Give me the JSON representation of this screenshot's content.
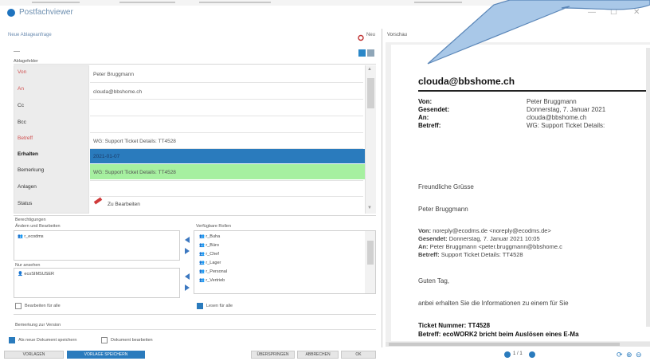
{
  "window": {
    "title": "Postfachviewer",
    "controls": [
      "—",
      "☐",
      "✕"
    ]
  },
  "left": {
    "header": "Neue Ablageanfrage",
    "new_label": "Neu",
    "group_title": "Ablagefelder",
    "fields": [
      {
        "label": "Von",
        "value": "Peter Bruggmann",
        "style": "red"
      },
      {
        "label": "An",
        "value": "clouda@bbshome.ch",
        "style": "red"
      },
      {
        "label": "Cc",
        "value": "",
        "style": "black"
      },
      {
        "label": "Bcc",
        "value": "",
        "style": "black"
      },
      {
        "label": "Betreff",
        "value": "WG: Support Ticket Details: TT4528",
        "style": "red"
      },
      {
        "label": "Erhalten",
        "value": "2021-01-07",
        "style": "bold"
      },
      {
        "label": "Bemerkung",
        "value": "WG: Support Ticket Details: TT4528",
        "style": "black"
      },
      {
        "label": "Anlagen",
        "value": "",
        "style": "black"
      },
      {
        "label": "Status",
        "value": "Zu Bearbeiten",
        "style": "black"
      }
    ],
    "permissions": {
      "title": "Berechtigungen",
      "read_write_caption": "Ändern und Bearbeiten",
      "read_write_items": [
        "r_ecodms"
      ],
      "read_only_caption": "Nur ansehen",
      "read_only_items": [
        "ecoSIMSUSER"
      ],
      "available_caption": "Verfügbare Rollen",
      "available_items": [
        "r_Buha",
        "r_Büro",
        "r_Chef",
        "r_Lager",
        "r_Personal",
        "r_Vertrieb"
      ],
      "edit_all_label": "Bearbeiten für alle",
      "read_all_label": "Lesen für alle"
    },
    "note_label": "Bemerkung zur Version",
    "option1_label": "Als neue Dokument speichern",
    "option2_label": "Dokument bearbeiten",
    "buttons": {
      "vorlagen": "VORLAGEN",
      "vorlage_speichern": "VORLAGE SPEICHERN",
      "ueberspringen": "ÜBERSPRINGEN",
      "abbrechen": "ABBRECHEN",
      "ok": "OK"
    }
  },
  "preview": {
    "label": "Vorschau",
    "mailbox": "clouda@bbshome.ch",
    "header_fields": [
      {
        "label": "Von:",
        "value": "Peter Bruggmann"
      },
      {
        "label": "Gesendet:",
        "value": "Donnerstag, 7. Januar 2021"
      },
      {
        "label": "An:",
        "value": "clouda@bbshome.ch"
      },
      {
        "label": "Betreff:",
        "value": "WG: Support Ticket Details:"
      }
    ],
    "greeting": "Freundliche Grüsse",
    "signature": "Peter Bruggmann",
    "fwd_von_label": "Von:",
    "fwd_von": "noreply@ecodms.de <noreply@ecodms.de>",
    "fwd_gesendet_label": "Gesendet:",
    "fwd_gesendet": "Donnerstag, 7. Januar 2021 10:05",
    "fwd_an_label": "An:",
    "fwd_an": "Peter Bruggmann <peter.bruggmann@bbshome.c",
    "fwd_betreff_label": "Betreff:",
    "fwd_betreff": "Support Ticket Details: TT4528",
    "salutation": "Guten Tag,",
    "body_line": "anbei erhalten Sie die Informationen zu einem für Sie",
    "ticket_label": "Ticket Nummer:",
    "ticket_value": "TT4528",
    "subject_label": "Betreff:",
    "subject_value": "ecoWORK2 bricht beim Auslösen eines E-Ma",
    "page_indicator": "1 / 1"
  },
  "colors": {
    "accent": "#2a7bbd",
    "highlight_green": "#a6f0a0",
    "required_label": "#d05050",
    "callout": "#9ec0e0"
  }
}
